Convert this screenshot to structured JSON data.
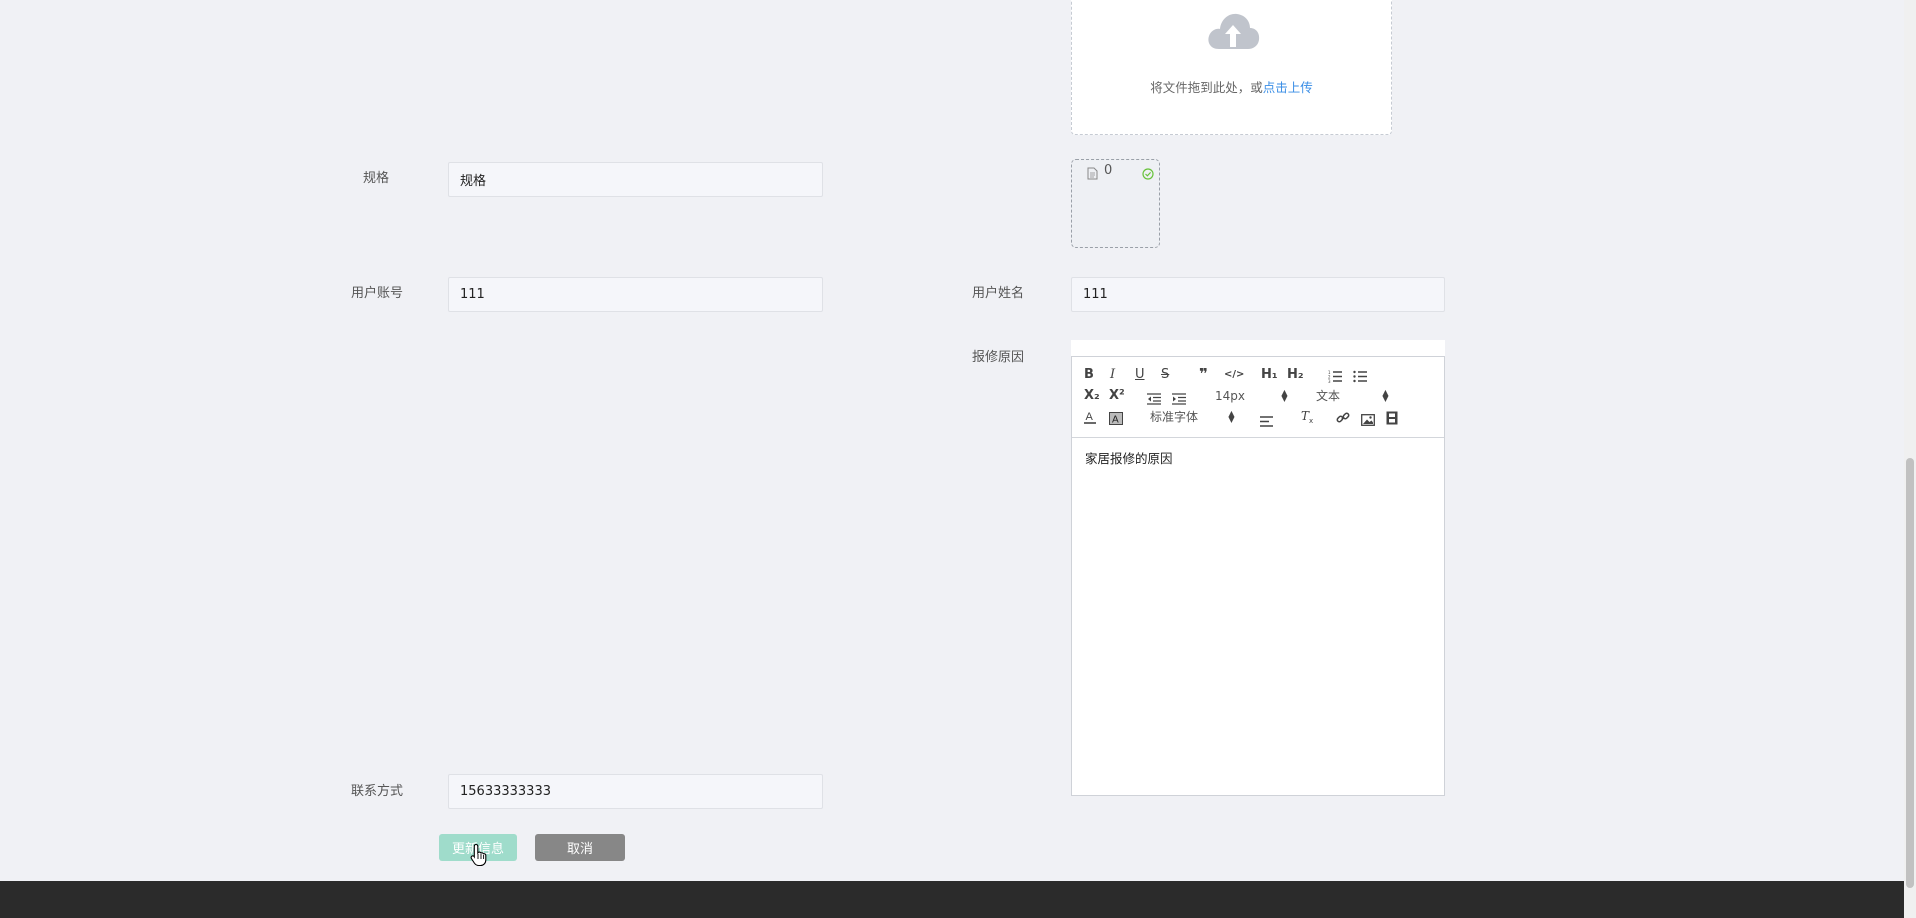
{
  "upload": {
    "text_prefix": "将文件拖到此处，或",
    "text_link": "点击上传",
    "file_count": "0"
  },
  "form": {
    "spec": {
      "label": "规格",
      "value": "规格"
    },
    "user_account": {
      "label": "用户账号",
      "value": "111"
    },
    "user_name": {
      "label": "用户姓名",
      "value": "111"
    },
    "repair_reason": {
      "label": "报修原因"
    },
    "contact": {
      "label": "联系方式",
      "value": "15633333333"
    }
  },
  "editor": {
    "toolbar": {
      "bold": "B",
      "italic": "I",
      "underline": "U",
      "strike": "S",
      "quote": "❞",
      "code": "</>",
      "h1": "H₁",
      "h2": "H₂",
      "subscript": "X₂",
      "superscript": "X²",
      "font_size": "14px",
      "text_style": "文本",
      "font_family": "标准字体"
    },
    "content": "家居报修的原因"
  },
  "buttons": {
    "update": "更新信息",
    "cancel": "取消"
  },
  "colors": {
    "background": "#f0f1f5",
    "update_button": "#9fdccb",
    "cancel_button": "#878787",
    "link": "#3a8ee6",
    "success": "#67c23a",
    "footer": "#2b2b2b"
  }
}
